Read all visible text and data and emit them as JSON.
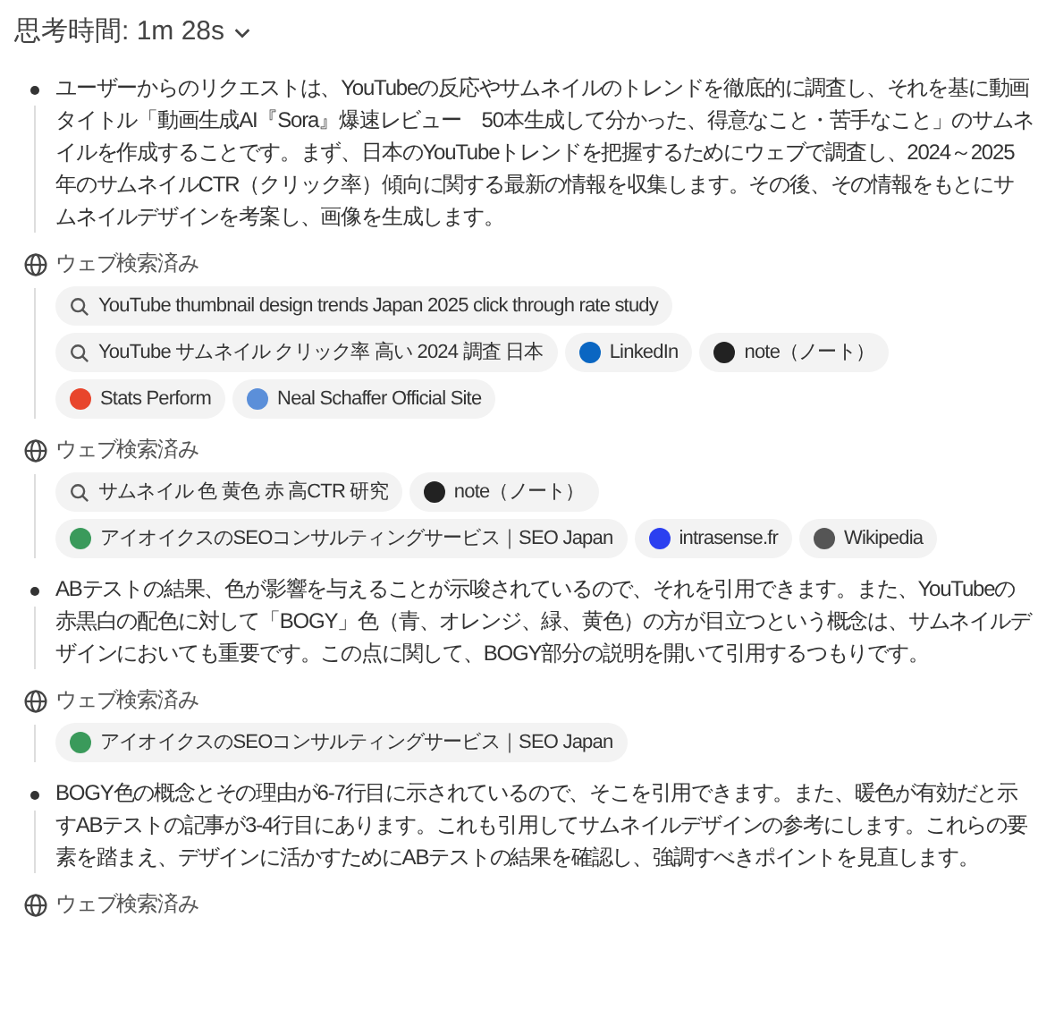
{
  "header": {
    "label": "思考時間: 1m 28s",
    "expanded": false
  },
  "steps": [
    {
      "kind": "thought",
      "text": "ユーザーからのリクエストは、YouTubeの反応やサムネイルのトレンドを徹底的に調査し、それを基に動画タイトル「動画生成AI『Sora』爆速レビュー　50本生成して分かった、得意なこと・苦手なこと」のサムネイルを作成することです。まず、日本のYouTubeトレンドを把握するためにウェブで調査し、2024～2025年のサムネイルCTR（クリック率）傾向に関する最新の情報を収集します。その後、その情報をもとにサムネイルデザインを考案し、画像を生成します。"
    },
    {
      "kind": "search",
      "label": "ウェブ検索済み",
      "chips": [
        {
          "kind": "query",
          "text": "YouTube thumbnail design trends Japan 2025 click through rate study"
        },
        {
          "kind": "query",
          "text": "YouTube サムネイル クリック率 高い 2024 調査 日本"
        },
        {
          "kind": "source",
          "text": "LinkedIn",
          "color": "#0a66c2"
        },
        {
          "kind": "source",
          "text": "note（ノート）",
          "color": "#222222"
        },
        {
          "kind": "source",
          "text": "Stats Perform",
          "color": "#e8452c"
        },
        {
          "kind": "source",
          "text": "Neal Schaffer Official Site",
          "color": "#5b8fd9"
        }
      ]
    },
    {
      "kind": "search",
      "label": "ウェブ検索済み",
      "chips": [
        {
          "kind": "query",
          "text": "サムネイル 色 黄色 赤 高CTR 研究"
        },
        {
          "kind": "source",
          "text": "note（ノート）",
          "color": "#222222"
        },
        {
          "kind": "source",
          "text": "アイオイクスのSEOコンサルティングサービス｜SEO Japan",
          "color": "#3a9a5b"
        },
        {
          "kind": "source",
          "text": "intrasense.fr",
          "color": "#2b3ff0"
        },
        {
          "kind": "source",
          "text": "Wikipedia",
          "color": "#555555"
        }
      ]
    },
    {
      "kind": "thought",
      "text": "ABテストの結果、色が影響を与えることが示唆されているので、それを引用できます。また、YouTubeの赤黒白の配色に対して「BOGY」色（青、オレンジ、緑、黄色）の方が目立つという概念は、サムネイルデザインにおいても重要です。この点に関して、BOGY部分の説明を開いて引用するつもりです。"
    },
    {
      "kind": "search",
      "label": "ウェブ検索済み",
      "chips": [
        {
          "kind": "source",
          "text": "アイオイクスのSEOコンサルティングサービス｜SEO Japan",
          "color": "#3a9a5b"
        }
      ]
    },
    {
      "kind": "thought",
      "text": "BOGY色の概念とその理由が6-7行目に示されているので、そこを引用できます。また、暖色が有効だと示すABテストの記事が3-4行目にあります。これも引用してサムネイルデザインの参考にします。これらの要素を踏まえ、デザインに活かすためにABテストの結果を確認し、強調すべきポイントを見直します。"
    },
    {
      "kind": "search",
      "label": "ウェブ検索済み"
    }
  ]
}
